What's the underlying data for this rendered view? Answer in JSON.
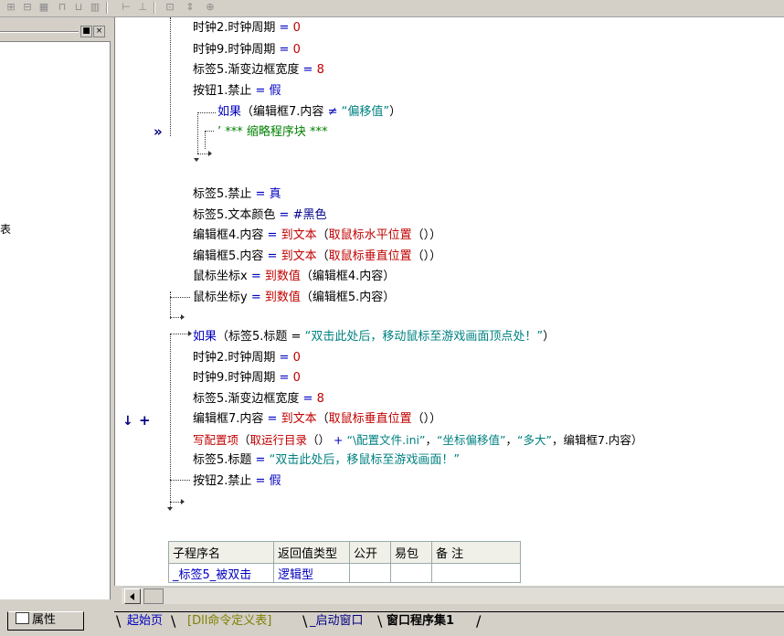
{
  "toolbar": {
    "icons": [
      "align-left-icon",
      "align-center-icon",
      "align-right-icon",
      "align-top-icon",
      "align-hcenter-icon",
      "align-bottom-icon",
      "same-width-icon",
      "same-height-icon",
      "same-size-icon"
    ]
  },
  "left_panel": {
    "truncated_text": "表",
    "properties_tab_label": "属性"
  },
  "gutter": {
    "current_marker": "»",
    "breakpoint_arrow": "↓",
    "breakpoint_plus": "+"
  },
  "code": {
    "l1": {
      "a": "时钟2.时钟周期",
      "op": " = ",
      "v": "0"
    },
    "l2": {
      "a": "时钟9.时钟周期",
      "op": " = ",
      "v": "0"
    },
    "l3": {
      "a": "标签5.渐变边框宽度",
      "op": " = ",
      "v": "8"
    },
    "l4": {
      "a": "按钮1.禁止",
      "op": " = ",
      "v": "假"
    },
    "l5": {
      "kw": "如果",
      "p1": "（编辑框7.内容 ",
      "ne": "≠",
      "s": " “偏移值”",
      "p2": "）"
    },
    "l6": {
      "t": "’ *** 缩略程序块 ***"
    },
    "l7": {
      "a": "标签5.禁止",
      "op": " = ",
      "v": "真"
    },
    "l8": {
      "a": "标签5.文本颜色",
      "op": " = ",
      "v": "#黑色"
    },
    "l9": {
      "a": "编辑框4.内容",
      "op": " = ",
      "f": "到文本",
      "p1": "（",
      "g": "取鼠标水平位置",
      "p2": "（））"
    },
    "l10": {
      "a": "编辑框5.内容",
      "op": " = ",
      "f": "到文本",
      "p1": "（",
      "g": "取鼠标垂直位置",
      "p2": "（））"
    },
    "l11": {
      "a": "鼠标坐标x",
      "op": " = ",
      "f": "到数值",
      "p": "（编辑框4.内容）"
    },
    "l12": {
      "a": "鼠标坐标y",
      "op": " = ",
      "f": "到数值",
      "p": "（编辑框5.内容）"
    },
    "l13": {
      "kw": "如果",
      "p1": "（标签5.标题 = ",
      "s": "“双击此处后，移动鼠标至游戏画面顶点处！”",
      "p2": "）"
    },
    "l14": {
      "a": "时钟2.时钟周期",
      "op": " = ",
      "v": "0"
    },
    "l15": {
      "a": "时钟9.时钟周期",
      "op": " = ",
      "v": "0"
    },
    "l16": {
      "a": "标签5.渐变边框宽度",
      "op": " = ",
      "v": "8"
    },
    "l17": {
      "a": "编辑框7.内容",
      "op": " = ",
      "f": "到文本",
      "p1": "（",
      "g": "取鼠标垂直位置",
      "p2": "（））"
    },
    "l18": {
      "f": "写配置项",
      "p1": "（",
      "g": "取运行目录",
      "p2": "（）",
      "plus": " + ",
      "s1": "“\\配置文件.ini”",
      "c1": "，",
      "s2": "“坐标偏移值”",
      "c2": "，",
      "s3": "“多大”",
      "c3": "，",
      "e": "编辑框7.内容）"
    },
    "l19": {
      "a": "标签5.标题",
      "op": " = ",
      "s": "“双击此处后，移鼠标至游戏画面！”"
    },
    "l20": {
      "a": "按钮2.禁止",
      "op": " = ",
      "v": "假"
    }
  },
  "sub_table": {
    "headers": [
      "子程序名",
      "返回值类型",
      "公开",
      "易包",
      "备 注"
    ],
    "row": [
      "_标签5_被双击",
      "逻辑型",
      "",
      "",
      ""
    ]
  },
  "tabs": [
    {
      "label": "起始页"
    },
    {
      "label": "[Dll命令定义表]"
    },
    {
      "label": "_启动窗口"
    },
    {
      "label": "窗口程序集1"
    }
  ]
}
